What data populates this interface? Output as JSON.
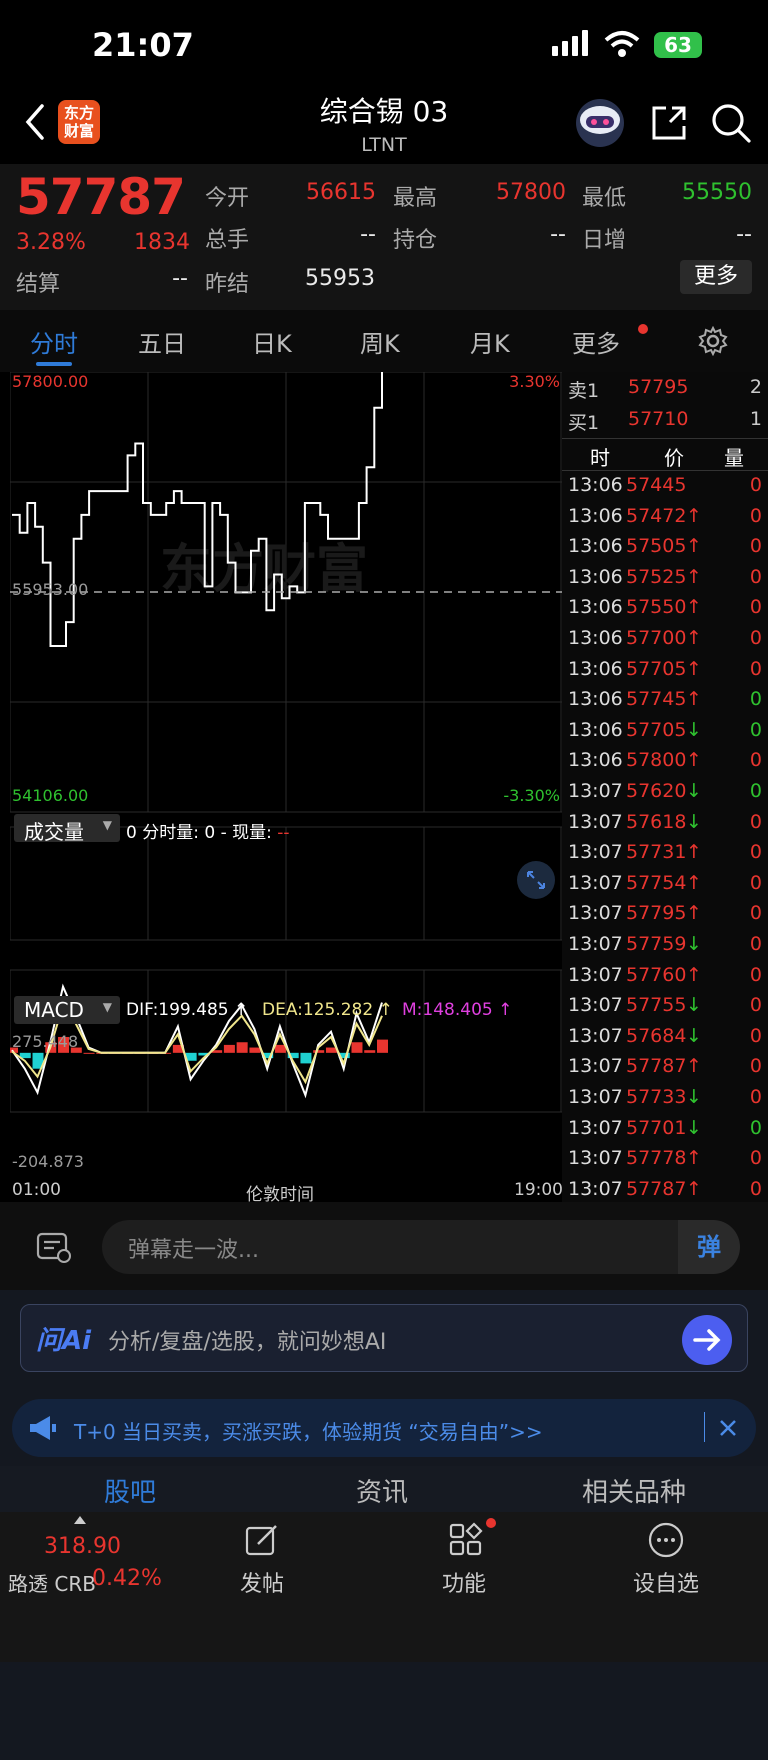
{
  "status": {
    "time": "21:07",
    "battery": "63"
  },
  "header": {
    "title": "综合锡 03",
    "subtitle": "LTNT",
    "logo_text": "东方财富"
  },
  "quote": {
    "price": "57787",
    "change_pct": "3.28%",
    "change": "1834",
    "settle_label": "结算",
    "settle_value": "--",
    "open_label": "今开",
    "open_value": "56615",
    "high_label": "最高",
    "high_value": "57800",
    "low_label": "最低",
    "low_value": "55550",
    "volume_label": "总手",
    "volume_value": "--",
    "position_label": "持仓",
    "position_value": "--",
    "daily_inc_label": "日增",
    "daily_inc_value": "--",
    "prev_settle_label": "昨结",
    "prev_settle_value": "55953",
    "more_label": "更多"
  },
  "tabs": [
    "分时",
    "五日",
    "日K",
    "周K",
    "月K",
    "更多"
  ],
  "chart": {
    "y_top_label": "57800.00",
    "y_mid_label": "55953.00",
    "y_bottom_label": "54106.00",
    "pct_top_label": "3.30%",
    "pct_bottom_label": "-3.30%",
    "watermark": "东方财富",
    "volume_title": "成交量",
    "volume_info": "0 分时量: 0 - 现量: ",
    "volume_current": "--",
    "macd_title": "MACD",
    "dif": "DIF:199.485 ↑",
    "dea": "DEA:125.282 ↑",
    "m": "M:148.405 ↑",
    "macd_top_label": "275.448",
    "macd_bottom_label": "-204.873",
    "x_start": "01:00",
    "x_mid": "伦敦时间",
    "x_end": "19:00",
    "colors": {
      "line": "#ffffff",
      "dif": "#ffffff",
      "dea": "#f0e68c",
      "up": "#e8352f",
      "down": "#1fd1d1"
    }
  },
  "chart_data": {
    "type": "line",
    "title": "",
    "ylim": [
      54106,
      57800
    ],
    "reference": 55953,
    "x_range": [
      "01:00",
      "19:00"
    ],
    "series": [
      {
        "values": [
          56600,
          56450,
          56700,
          56500,
          56200,
          55500,
          55500,
          55700,
          56400,
          56600,
          56800,
          56800,
          56800,
          56800,
          56800,
          57100,
          57200,
          56700,
          56600,
          56600,
          56700,
          56800,
          56700,
          56700,
          56700,
          56000,
          56700,
          56600,
          56200,
          55950,
          55950,
          56300,
          56400,
          55800,
          56100,
          55900,
          56000,
          55950,
          56700,
          56700,
          56600,
          56400,
          56400,
          56400,
          56400,
          56700,
          57000,
          57500,
          57800
        ]
      }
    ],
    "macd": {
      "ylim": [
        -204.873,
        275.448
      ],
      "dif": [
        10,
        -60,
        -150,
        40,
        250,
        140,
        20,
        0,
        0,
        0,
        0,
        0,
        0,
        100,
        -100,
        -30,
        30,
        120,
        180,
        90,
        -60,
        100,
        -40,
        -160,
        30,
        80,
        -60,
        150,
        40,
        190
      ],
      "dea": [
        5,
        -30,
        -90,
        20,
        180,
        110,
        15,
        0,
        0,
        0,
        0,
        0,
        0,
        70,
        -70,
        -20,
        20,
        90,
        140,
        70,
        -40,
        70,
        -30,
        -110,
        20,
        60,
        -40,
        110,
        30,
        140
      ],
      "hist": [
        20,
        -20,
        -60,
        40,
        60,
        20,
        0,
        0,
        0,
        0,
        0,
        0,
        0,
        30,
        -30,
        -10,
        10,
        30,
        40,
        20,
        -20,
        30,
        -20,
        -40,
        10,
        20,
        -20,
        40,
        10,
        50
      ]
    }
  },
  "orderbook": [
    {
      "label": "卖1",
      "price": "57795",
      "qty": "2"
    },
    {
      "label": "买1",
      "price": "57710",
      "qty": "1"
    }
  ],
  "trades_header": {
    "time": "时",
    "price": "价",
    "qty": "量"
  },
  "trades": [
    {
      "time": "13:06",
      "price": "57445",
      "dir": "",
      "qty": "0"
    },
    {
      "time": "13:06",
      "price": "57472",
      "dir": "↑",
      "qty": "0"
    },
    {
      "time": "13:06",
      "price": "57505",
      "dir": "↑",
      "qty": "0"
    },
    {
      "time": "13:06",
      "price": "57525",
      "dir": "↑",
      "qty": "0"
    },
    {
      "time": "13:06",
      "price": "57550",
      "dir": "↑",
      "qty": "0"
    },
    {
      "time": "13:06",
      "price": "57700",
      "dir": "↑",
      "qty": "0"
    },
    {
      "time": "13:06",
      "price": "57705",
      "dir": "↑",
      "qty": "0"
    },
    {
      "time": "13:06",
      "price": "57745",
      "dir": "↑",
      "qty": "0"
    },
    {
      "time": "13:06",
      "price": "57705",
      "dir": "↓",
      "qty": "0"
    },
    {
      "time": "13:06",
      "price": "57800",
      "dir": "↑",
      "qty": "0"
    },
    {
      "time": "13:07",
      "price": "57620",
      "dir": "↓",
      "qty": "0"
    },
    {
      "time": "13:07",
      "price": "57618",
      "dir": "↓",
      "qty": "0"
    },
    {
      "time": "13:07",
      "price": "57731",
      "dir": "↑",
      "qty": "0"
    },
    {
      "time": "13:07",
      "price": "57754",
      "dir": "↑",
      "qty": "0"
    },
    {
      "time": "13:07",
      "price": "57795",
      "dir": "↑",
      "qty": "0"
    },
    {
      "time": "13:07",
      "price": "57759",
      "dir": "↓",
      "qty": "0"
    },
    {
      "time": "13:07",
      "price": "57760",
      "dir": "↑",
      "qty": "0"
    },
    {
      "time": "13:07",
      "price": "57755",
      "dir": "↓",
      "qty": "0"
    },
    {
      "time": "13:07",
      "price": "57684",
      "dir": "↓",
      "qty": "0"
    },
    {
      "time": "13:07",
      "price": "57787",
      "dir": "↑",
      "qty": "0"
    },
    {
      "time": "13:07",
      "price": "57733",
      "dir": "↓",
      "qty": "0"
    },
    {
      "time": "13:07",
      "price": "57701",
      "dir": "↓",
      "qty": "0"
    },
    {
      "time": "13:07",
      "price": "57778",
      "dir": "↑",
      "qty": "0"
    },
    {
      "time": "13:07",
      "price": "57787",
      "dir": "↑",
      "qty": "0"
    }
  ],
  "trade_qty_colors": [
    "red",
    "red",
    "red",
    "red",
    "red",
    "red",
    "red",
    "green",
    "green",
    "red",
    "green",
    "red",
    "red",
    "red",
    "red",
    "red",
    "red",
    "red",
    "red",
    "red",
    "red",
    "green",
    "red",
    "red"
  ],
  "comment": {
    "placeholder": "弹幕走一波...",
    "danmu_btn": "弹"
  },
  "ai": {
    "logo": "问Ai",
    "placeholder": "分析/复盘/选股，就问妙想AI"
  },
  "promo": {
    "text": "T+0 当日买卖，买涨买跌，体验期货 “交易自由”>>"
  },
  "sub_tabs": [
    "股吧",
    "资讯",
    "相关品种"
  ],
  "bottom_nav": {
    "ticker_value": "318.90",
    "ticker_name": "路透 CRB",
    "ticker_pct": "0.42%",
    "post": "发帖",
    "features": "功能",
    "watchlist": "设自选"
  }
}
